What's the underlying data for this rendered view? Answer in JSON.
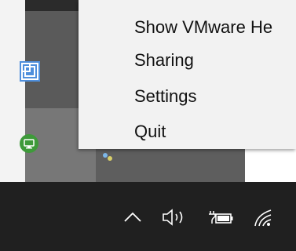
{
  "context_menu": {
    "items": [
      {
        "label": "Show VMware He"
      },
      {
        "label": "Sharing"
      },
      {
        "label": "Settings"
      },
      {
        "label": "Quit"
      }
    ]
  },
  "tray_overflow": {
    "icons": [
      "vmware-icon",
      "green-app-icon"
    ]
  },
  "taskbar": {
    "icons": [
      "chevron-up-icon",
      "volume-icon",
      "battery-icon",
      "wifi-icon"
    ]
  },
  "colors": {
    "menu_background": "#f2f2f2",
    "taskbar_background": "#202020",
    "overflow_panel": "#5a5a5a",
    "vmware_blue": "#4f8fdc",
    "green_app": "#3e9a3a"
  }
}
